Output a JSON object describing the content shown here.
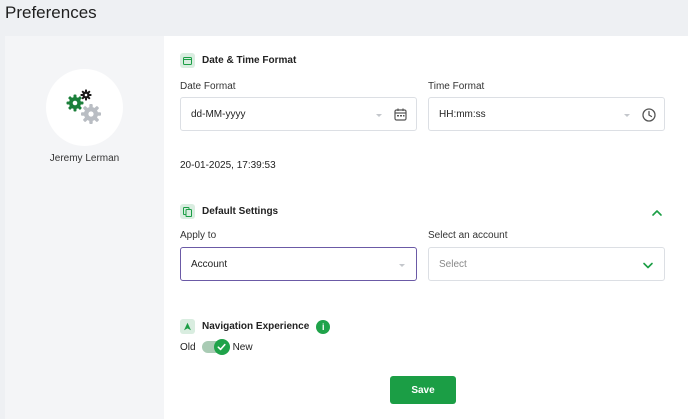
{
  "page": {
    "title": "Preferences"
  },
  "profile": {
    "name": "Jeremy Lerman"
  },
  "date_time": {
    "section_title": "Date & Time Format",
    "date_label": "Date Format",
    "date_value": "dd-MM-yyyy",
    "time_label": "Time Format",
    "time_value": "HH:mm:ss",
    "preview": "20-01-2025, 17:39:53"
  },
  "default_settings": {
    "section_title": "Default Settings",
    "apply_label": "Apply to",
    "apply_value": "Account",
    "account_label": "Select an account",
    "account_placeholder": "Select"
  },
  "navigation": {
    "section_title": "Navigation Experience",
    "info_glyph": "i",
    "old_label": "Old",
    "new_label": "New",
    "toggle_on": true
  },
  "actions": {
    "save_label": "Save"
  },
  "colors": {
    "accent": "#1b9e45",
    "active_border": "#6b5aa6"
  },
  "icons": [
    "gears-icon",
    "calendar-icon",
    "clock-icon",
    "copy-icon",
    "navigation-arrow-icon",
    "info-icon",
    "chevron-up-icon",
    "chevron-down-icon",
    "check-icon"
  ]
}
